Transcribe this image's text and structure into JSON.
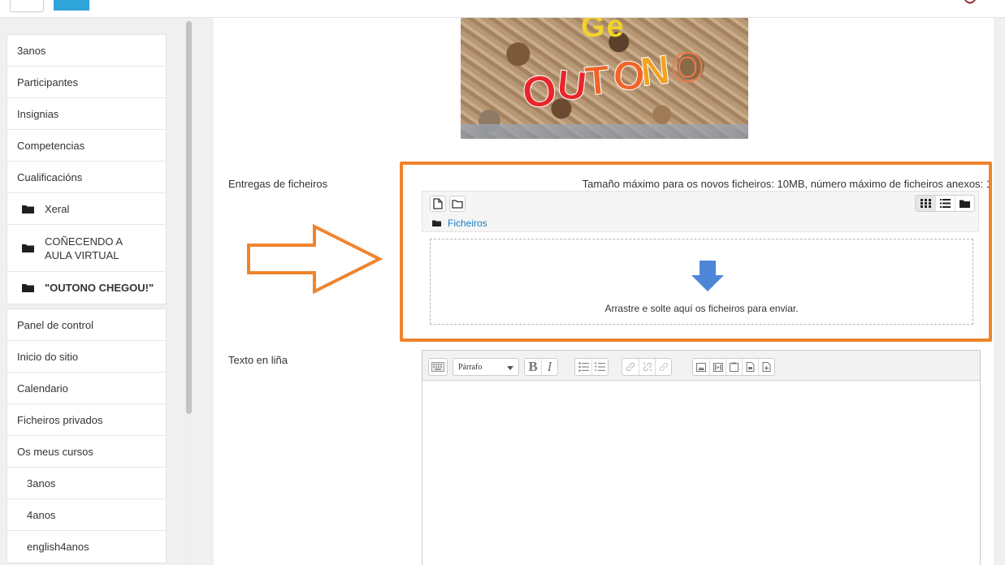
{
  "sidebar": {
    "course_nav": [
      {
        "label": "3anos"
      },
      {
        "label": "Participantes"
      },
      {
        "label": "Insignias"
      },
      {
        "label": "Competencias"
      },
      {
        "label": "Cualificacións"
      },
      {
        "label": "Xeral"
      },
      {
        "label": "COÑECENDO A AULA VIRTUAL"
      },
      {
        "label": "\"OUTONO CHEGOU!\""
      }
    ],
    "site_nav": [
      {
        "label": "Panel de control"
      },
      {
        "label": "Inicio do sitio"
      },
      {
        "label": "Calendario"
      },
      {
        "label": "Ficheiros privados"
      },
      {
        "label": "Os meus cursos"
      },
      {
        "label": "3anos"
      },
      {
        "label": "4anos"
      },
      {
        "label": "english4anos"
      }
    ]
  },
  "hero_image": {
    "top_text": "Ge",
    "letters": [
      {
        "char": "O",
        "color": "#e8262a"
      },
      {
        "char": "U",
        "color": "#e8262a"
      },
      {
        "char": "T",
        "color": "#f0642a"
      },
      {
        "char": "O",
        "color": "#f0642a"
      },
      {
        "char": "N",
        "color": "#f2a21e"
      },
      {
        "char": "O",
        "color": "#f27a4a"
      }
    ]
  },
  "form": {
    "files_label": "Entregas de ficheiros",
    "limits_text": "Tamaño máximo para os novos ficheiros: 10MB, número máximo de ficheiros anexos: 1",
    "path_link": "Ficheiros",
    "dropzone_text": "Arrastre e solte aquí os ficheiros para enviar.",
    "online_text_label": "Texto en liña",
    "format_select": "Párrafo"
  },
  "colors": {
    "highlight": "#f0842c",
    "link": "#1a7ec4",
    "upload_arrow": "#4d86d6"
  }
}
